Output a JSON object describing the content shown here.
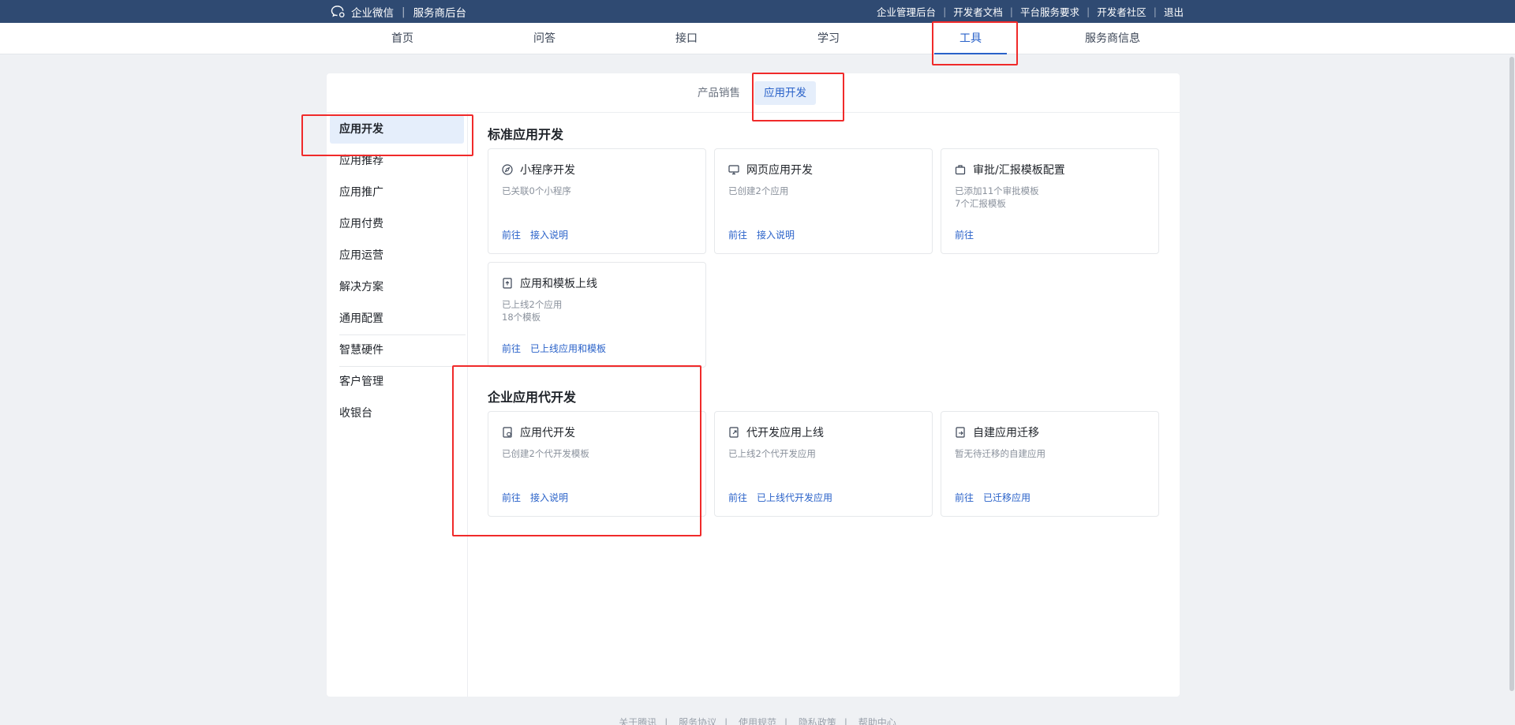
{
  "topbar": {
    "brand": "企业微信",
    "subtitle": "服务商后台",
    "links": [
      "企业管理后台",
      "开发者文档",
      "平台服务要求",
      "开发者社区",
      "退出"
    ]
  },
  "nav": {
    "items": [
      "首页",
      "问答",
      "接口",
      "学习",
      "工具",
      "服务商信息"
    ],
    "active": "工具"
  },
  "subtabs": {
    "items": [
      "产品销售",
      "应用开发"
    ],
    "active": "应用开发"
  },
  "sidebar": {
    "items": [
      "应用开发",
      "应用推荐",
      "应用推广",
      "应用付费",
      "应用运营",
      "解决方案",
      "通用配置",
      "智慧硬件",
      "客户管理",
      "收银台"
    ],
    "active": "应用开发"
  },
  "sections": [
    {
      "title": "标准应用开发",
      "cards": [
        {
          "title": "小程序开发",
          "icon": "compass-icon",
          "desc": [
            "已关联0个小程序"
          ],
          "actions": [
            "前往",
            "接入说明"
          ]
        },
        {
          "title": "网页应用开发",
          "icon": "monitor-icon",
          "desc": [
            "已创建2个应用"
          ],
          "actions": [
            "前往",
            "接入说明"
          ]
        },
        {
          "title": "审批/汇报模板配置",
          "icon": "briefcase-icon",
          "desc": [
            "已添加11个审批模板",
            "7个汇报模板"
          ],
          "actions": [
            "前往"
          ]
        },
        {
          "title": "应用和模板上线",
          "icon": "upload-doc-icon",
          "desc": [
            "已上线2个应用",
            "18个模板"
          ],
          "actions": [
            "前往",
            "已上线应用和模板"
          ]
        }
      ]
    },
    {
      "title": "企业应用代开发",
      "cards": [
        {
          "title": "应用代开发",
          "icon": "code-doc-icon",
          "desc": [
            "已创建2个代开发模板"
          ],
          "actions": [
            "前往",
            "接入说明"
          ]
        },
        {
          "title": "代开发应用上线",
          "icon": "launch-doc-icon",
          "desc": [
            "已上线2个代开发应用"
          ],
          "actions": [
            "前往",
            "已上线代开发应用"
          ]
        },
        {
          "title": "自建应用迁移",
          "icon": "migrate-doc-icon",
          "desc": [
            "暂无待迁移的自建应用"
          ],
          "actions": [
            "前往",
            "已迁移应用"
          ]
        }
      ]
    }
  ],
  "footer": [
    "关于腾讯",
    "服务协议",
    "使用规范",
    "隐私政策",
    "帮助中心"
  ],
  "colors": {
    "topbar": "#2f4a72",
    "accent": "#2a62c9",
    "highlight": "#f02a2a"
  }
}
